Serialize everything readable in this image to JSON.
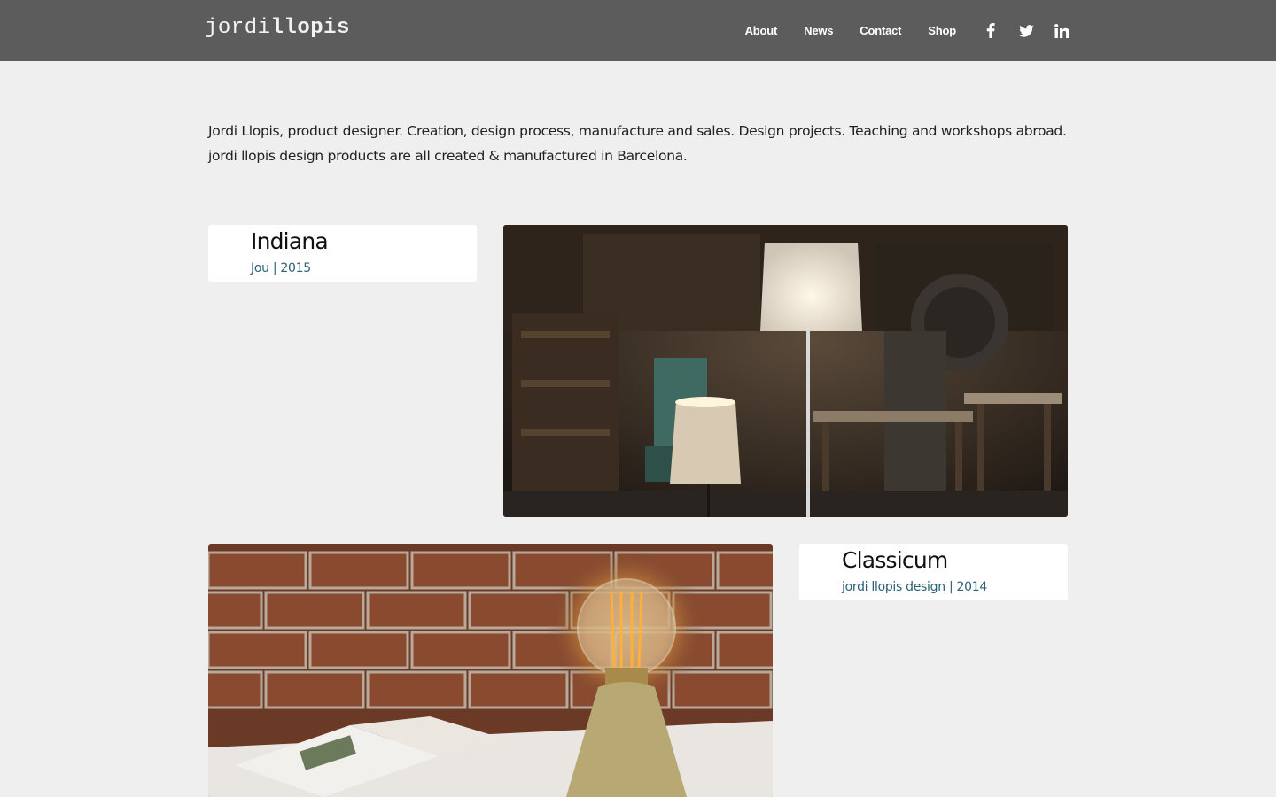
{
  "header": {
    "logo_light": "jordi",
    "logo_bold": "llopis",
    "nav": [
      {
        "label": "About"
      },
      {
        "label": "News"
      },
      {
        "label": "Contact"
      },
      {
        "label": "Shop"
      }
    ],
    "social": [
      {
        "icon": "facebook-icon"
      },
      {
        "icon": "twitter-icon"
      },
      {
        "icon": "linkedin-icon"
      }
    ]
  },
  "intro": "Jordi Llopis, product designer. Creation, design process, manufacture and sales. Design projects. Teaching and workshops abroad. jordi llopis design products are all created & manufactured in Barcelona.",
  "projects": [
    {
      "title": "Indiana",
      "meta": "Jou | 2015"
    },
    {
      "title": "Classicum",
      "meta": "jordi llopis design | 2014"
    }
  ],
  "colors": {
    "header_bg": "#5c5c5c",
    "page_bg": "#efefef",
    "meta_text": "#2b6076"
  }
}
